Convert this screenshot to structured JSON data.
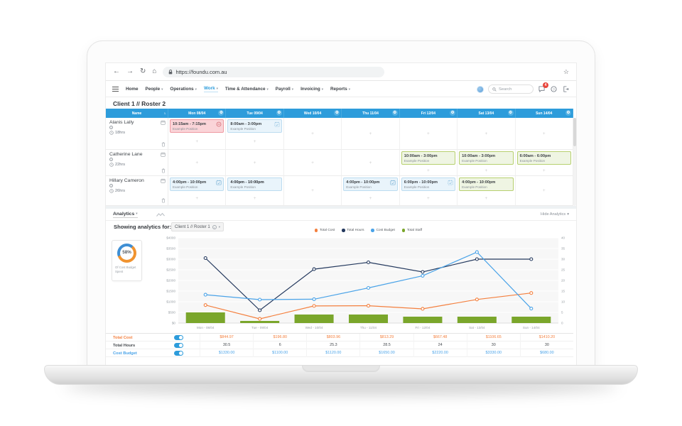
{
  "browser": {
    "url": "https://foundu.com.au",
    "star": "☆"
  },
  "nav": {
    "items": [
      {
        "label": "Home",
        "caret": false,
        "active": false
      },
      {
        "label": "People",
        "caret": true,
        "active": false
      },
      {
        "label": "Operations",
        "caret": true,
        "active": false
      },
      {
        "label": "Work",
        "caret": true,
        "active": true
      },
      {
        "label": "Time & Attendance",
        "caret": true,
        "active": false
      },
      {
        "label": "Payroll",
        "caret": true,
        "active": false
      },
      {
        "label": "Invoicing",
        "caret": true,
        "active": false
      },
      {
        "label": "Reports",
        "caret": true,
        "active": false
      }
    ],
    "search_placeholder": "Search",
    "notification_count": "4"
  },
  "page": {
    "title": "Client 1 // Roster 2"
  },
  "roster": {
    "columns": [
      "Name",
      "Mon 08/04",
      "Tue 09/04",
      "Wed 10/04",
      "Thu 11/04",
      "Fri 12/04",
      "Sat 13/04",
      "Sun 14/04"
    ],
    "rows": [
      {
        "name": "Alanis Lally",
        "hours": "18hrs",
        "shifts": [
          {
            "day": 0,
            "time": "10:15am - 7:15pm",
            "position": "Example Position",
            "style": "pink",
            "icon": "minus"
          },
          {
            "day": 1,
            "time": "8:00am - 3:00pm",
            "position": "Example Position",
            "style": "blue",
            "icon": "cal-dash"
          }
        ]
      },
      {
        "name": "Catherine Lane",
        "hours": "22hrs",
        "shifts": [
          {
            "day": 4,
            "time": "10:00am - 3:00pm",
            "position": "Example Position",
            "style": "green"
          },
          {
            "day": 5,
            "time": "10:00am - 3:00pm",
            "position": "Example Position",
            "style": "green"
          },
          {
            "day": 6,
            "time": "6:00am - 6:00pm",
            "position": "Example Position",
            "style": "green"
          }
        ]
      },
      {
        "name": "Hillary Cameron",
        "hours": "26hrs",
        "shifts": [
          {
            "day": 0,
            "time": "4:00pm - 10:00pm",
            "position": "Example Position",
            "style": "blue",
            "icon": "cal"
          },
          {
            "day": 1,
            "time": "4:00pm - 10:00pm",
            "position": "Example Position",
            "style": "blue",
            "bold": true
          },
          {
            "day": 3,
            "time": "4:00pm - 10:00pm",
            "position": "Example Position",
            "style": "blue",
            "icon": "cal"
          },
          {
            "day": 4,
            "time": "6:00pm - 10:00pm",
            "position": "Example Position",
            "style": "blue",
            "icon": "cal-dash"
          },
          {
            "day": 5,
            "time": "4:00pm - 10:00pm",
            "position": "Example Position",
            "style": "green"
          }
        ]
      }
    ]
  },
  "analytics": {
    "tab_label": "Analytics",
    "hide_label": "Hide Analytics",
    "showing_label": "Showing analytics for:",
    "roster_select": "Client 1 // Roster 1",
    "donut": {
      "percent": "58%",
      "label": "Of Cost Budget Spent",
      "spent_color": "#f0932f",
      "remaining_color": "#3f8fd4"
    }
  },
  "chart_data": {
    "type": "mixed",
    "categories": [
      "Mon - 08/04",
      "Tue - 09/04",
      "Wed - 10/04",
      "Thu - 11/04",
      "Fri - 12/04",
      "Sat - 13/04",
      "Sun - 14/04"
    ],
    "series": [
      {
        "name": "Total Cost",
        "type": "line",
        "axis": "left",
        "color": "#f4803f",
        "values": [
          844.97,
          196.8,
          803.96,
          813.29,
          667.48,
          1106.65,
          1410.2
        ]
      },
      {
        "name": "Total Hours",
        "type": "line",
        "axis": "right",
        "color": "#24395e",
        "values": [
          30.5,
          6,
          25.3,
          28.5,
          24,
          30,
          30
        ]
      },
      {
        "name": "Cost Budget",
        "type": "line",
        "axis": "right_scaled_left",
        "color": "#4aa3e8",
        "values": [
          1330,
          1100,
          1120,
          1650,
          2220,
          3330,
          680
        ]
      },
      {
        "name": "Total Staff",
        "type": "bar",
        "axis": "right",
        "color": "#7aa62b",
        "values": [
          5,
          1,
          4,
          4,
          3,
          3,
          3
        ]
      }
    ],
    "left_axis": {
      "label": "",
      "max": 4000,
      "ticks": [
        "$4000",
        "$3500",
        "$3000",
        "$2500",
        "$2000",
        "$1500",
        "$1000",
        "$500",
        "$0"
      ]
    },
    "right_axis": {
      "label": "",
      "max": 40,
      "ticks": [
        "40",
        "35",
        "30",
        "25",
        "20",
        "15",
        "10",
        "5",
        "0"
      ]
    },
    "grid": true,
    "legend_position": "top-center"
  },
  "summary_table": {
    "rows": [
      {
        "label": "Total Cost",
        "color": "#f4803f",
        "values": [
          "$844.97",
          "$196.80",
          "$803.96",
          "$813.29",
          "$667.48",
          "$1106.65",
          "$1410.20"
        ]
      },
      {
        "label": "Total Hours",
        "color": "#45494e",
        "values": [
          "30.5",
          "6",
          "25.3",
          "28.5",
          "24",
          "30",
          "30"
        ]
      },
      {
        "label": "Cost Budget",
        "color": "#4aa3e8",
        "values": [
          "$1330.00",
          "$1100.00",
          "$1120.00",
          "$1650.00",
          "$2220.00",
          "$3330.00",
          "$680.00"
        ]
      }
    ]
  }
}
